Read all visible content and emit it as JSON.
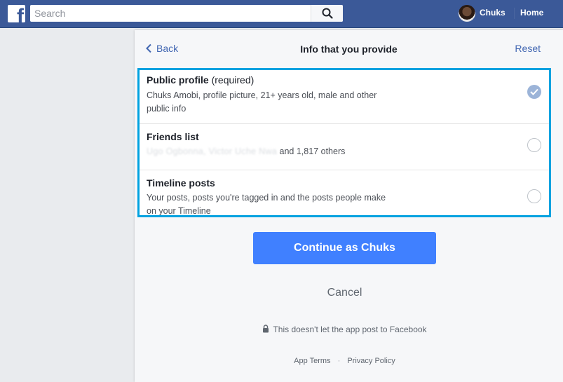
{
  "topbar": {
    "logo": "f",
    "search_placeholder": "Search",
    "user_name": "Chuks",
    "home_label": "Home"
  },
  "dialog": {
    "back_label": "Back",
    "title": "Info that you provide",
    "reset_label": "Reset",
    "permissions": [
      {
        "title": "Public profile",
        "suffix": "(required)",
        "description": "Chuks Amobi, profile picture, 21+ years old, male and other public info",
        "checked": true
      },
      {
        "title": "Friends list",
        "blurred_names": "Ugo Ogbonna, Victor Uche Nwa",
        "description_tail": "and 1,817 others",
        "checked": false
      },
      {
        "title": "Timeline posts",
        "description": "Your posts, posts you're tagged in and the posts people make on your Timeline",
        "checked": false
      }
    ],
    "continue_label": "Continue as Chuks",
    "cancel_label": "Cancel",
    "no_post_note": "This doesn't let the app post to Facebook",
    "footer": {
      "app_terms": "App Terms",
      "separator": "·",
      "privacy_policy": "Privacy Policy"
    }
  },
  "colors": {
    "facebook_blue": "#3b5998",
    "button_blue": "#4080ff",
    "highlight_border": "#00a2e0",
    "link_blue": "#4267b2"
  }
}
